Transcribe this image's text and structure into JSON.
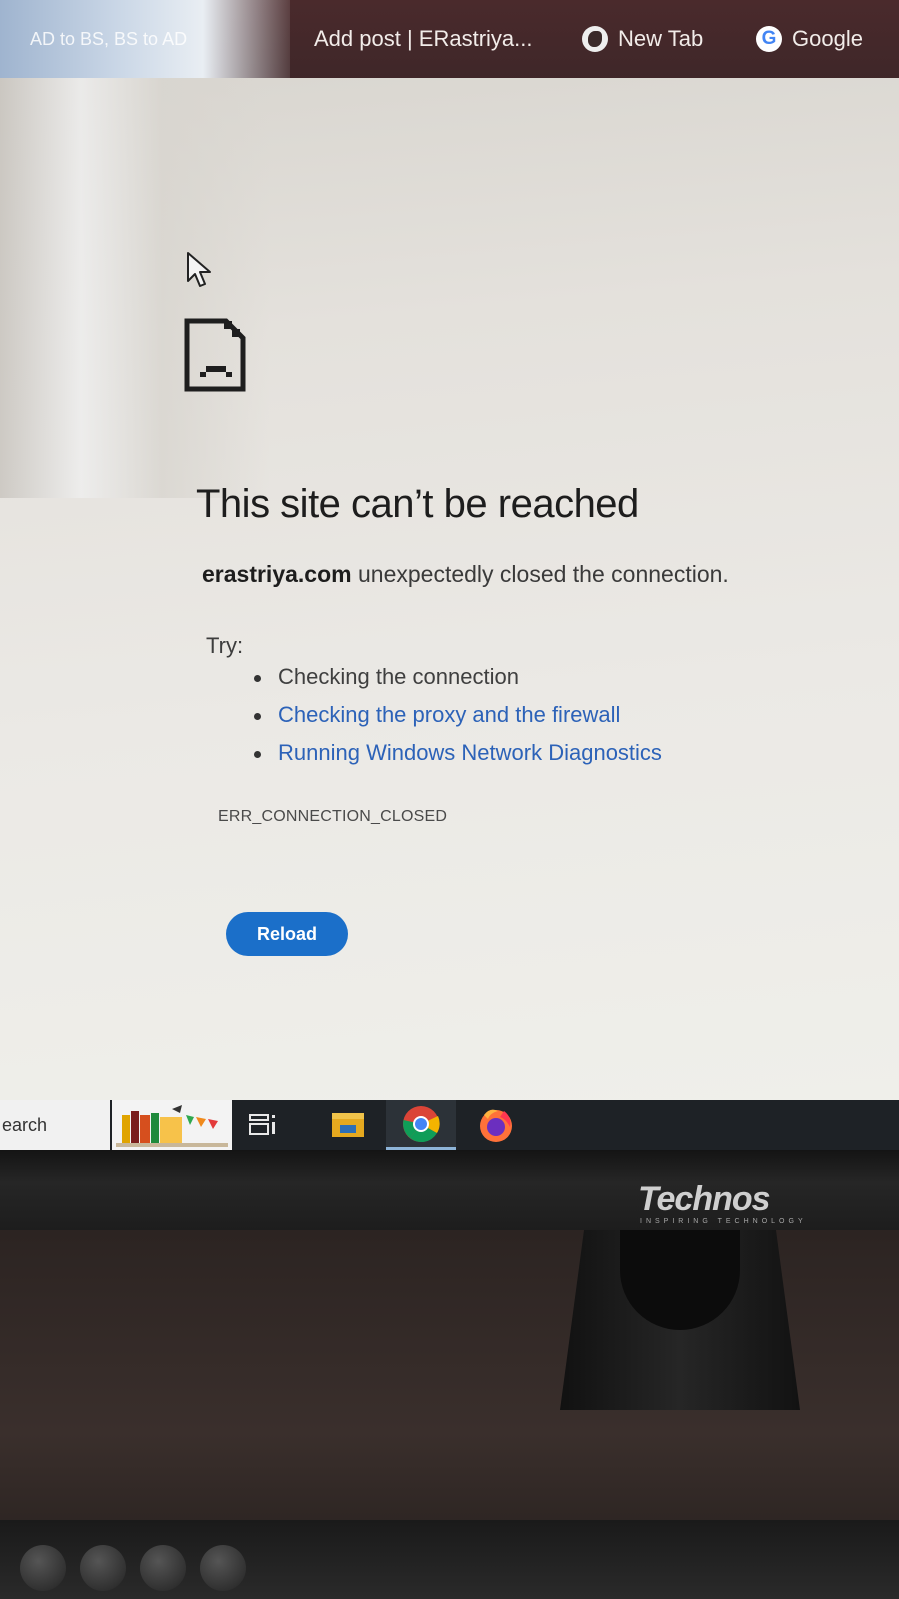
{
  "bookmarks_bar": {
    "items": [
      {
        "label": "AD to BS, BS to AD",
        "icon": "calendar-icon"
      },
      {
        "label": "Add post | ERastriya...",
        "icon": "none"
      },
      {
        "label": "New Tab",
        "icon": "globe-icon"
      },
      {
        "label": "Google",
        "icon": "google-icon"
      }
    ]
  },
  "error_page": {
    "icon": "sad-page-icon",
    "title": "This site can’t be reached",
    "domain": "erastriya.com",
    "message": " unexpectedly closed the connection.",
    "try_label": "Try:",
    "suggestions": [
      {
        "text": "Checking the connection",
        "is_link": false
      },
      {
        "text": "Checking the proxy and the firewall",
        "is_link": true
      },
      {
        "text": "Running Windows Network Diagnostics",
        "is_link": true
      }
    ],
    "error_code": "ERR_CONNECTION_CLOSED",
    "reload_label": "Reload"
  },
  "taskbar": {
    "search_text": "earch",
    "apps": [
      "books-icon",
      "task-view-icon",
      "file-explorer-icon",
      "chrome-icon",
      "firefox-icon"
    ],
    "active_app": "chrome-icon"
  },
  "monitor": {
    "brand": "Technos",
    "tagline": "INSPIRING TECHNOLOGY"
  },
  "colors": {
    "link": "#2c62b8",
    "reload_button": "#1b6fc9",
    "bookmarks_bar": "#3d2628",
    "taskbar": "#1e2226"
  }
}
